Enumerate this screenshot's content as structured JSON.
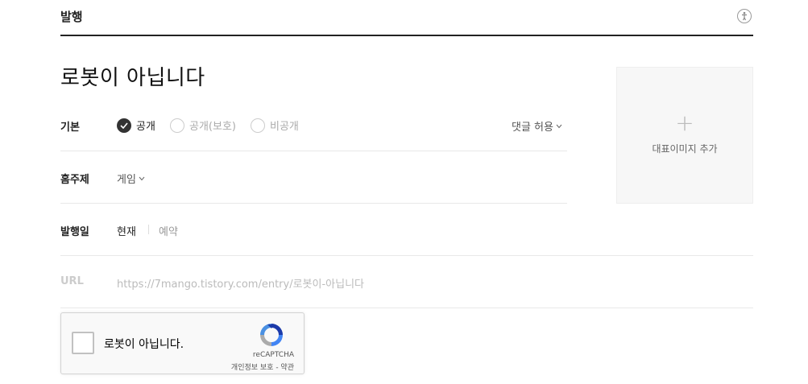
{
  "header": {
    "title": "발행",
    "help_icon": "info-icon"
  },
  "post": {
    "title": "로봇이 아닙니다"
  },
  "visibility": {
    "label": "기본",
    "options": [
      {
        "label": "공개",
        "checked": true
      },
      {
        "label": "공개(보호)",
        "checked": false
      },
      {
        "label": "비공개",
        "checked": false
      }
    ],
    "comments_label": "댓글 허용"
  },
  "topic": {
    "label": "홈주제",
    "value": "게임"
  },
  "publish_date": {
    "label": "발행일",
    "now": "현재",
    "reserve": "예약"
  },
  "url": {
    "label": "URL",
    "value": "https://7mango.tistory.com/entry/로봇이-아닙니다"
  },
  "thumbnail": {
    "plus": "+",
    "label": "대표이미지 추가"
  },
  "recaptcha": {
    "checkbox_label": "로봇이 아닙니다.",
    "brand": "reCAPTCHA",
    "links": "개인정보 보호 - 약관"
  }
}
